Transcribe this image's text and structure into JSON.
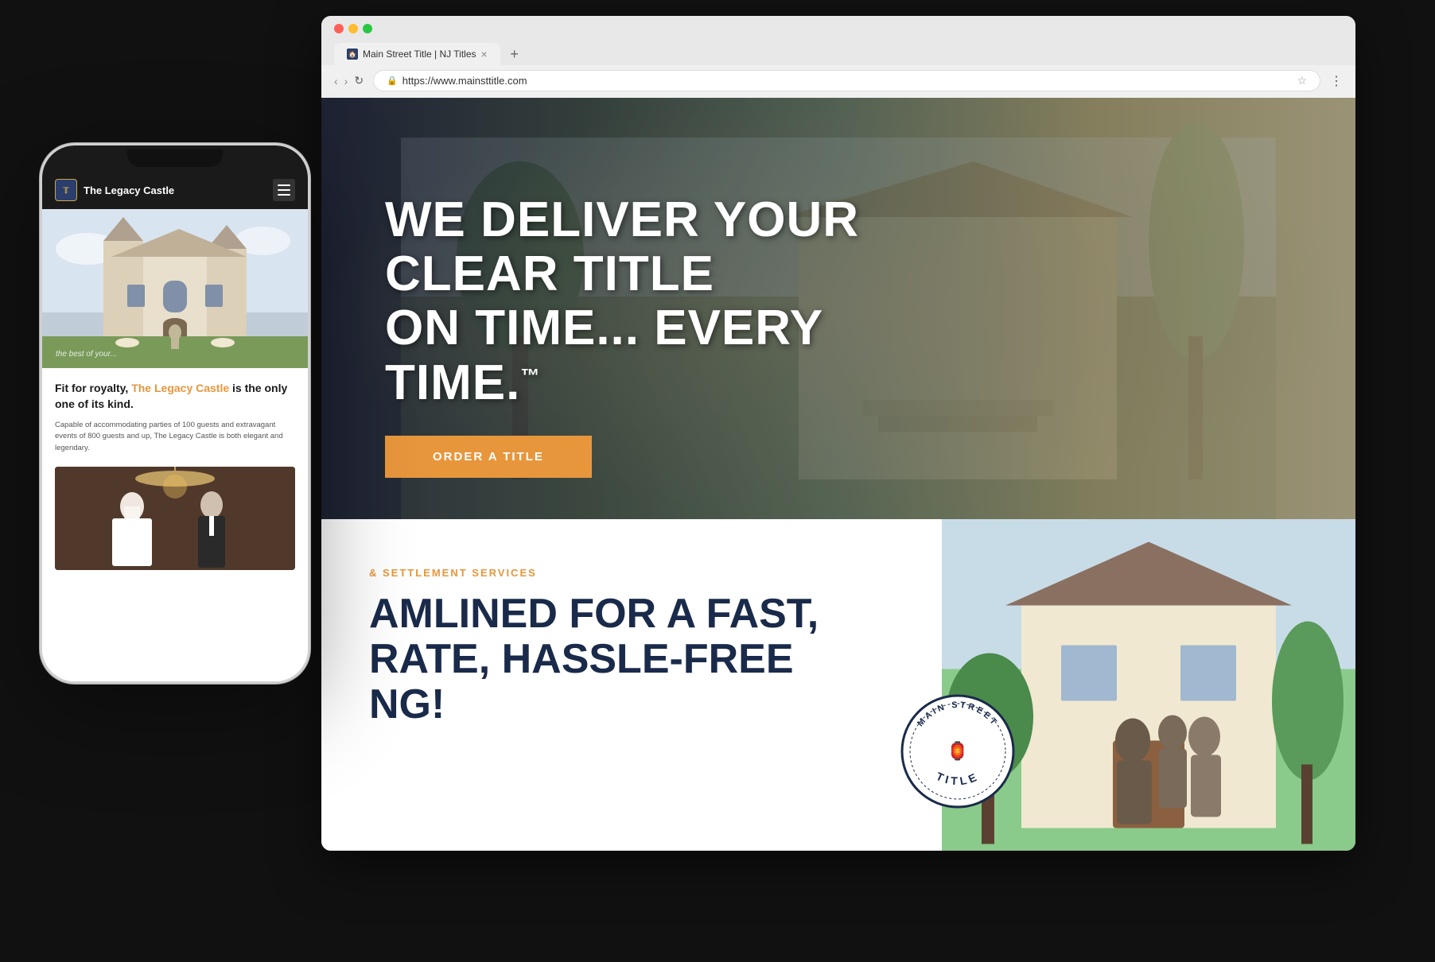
{
  "scene": {
    "bg_color": "#111111"
  },
  "browser": {
    "dots": [
      "#ff5f57",
      "#febc2e",
      "#28c840"
    ],
    "tab": {
      "label": "Main Street Title | NJ Titles",
      "favicon_text": "🏠"
    },
    "tab_new": "+",
    "nav": {
      "back": "‹",
      "forward": "›",
      "refresh": "↻",
      "url": "https://www.mainsttitle.com",
      "bookmark": "☆",
      "more": "⋮"
    }
  },
  "hero": {
    "headline_line1": "WE DELIVER YOUR CLEAR TITLE",
    "headline_line2": "ON TIME... EVERY TIME.",
    "trademark": "™",
    "cta_label": "ORDER A TITLE"
  },
  "services": {
    "label": "& SETTLEMENT SERVICES",
    "headline_line1": "AMLINED FOR A FAST,",
    "headline_line2": "RATE, HASSLE-FREE",
    "headline_line3": "NG!"
  },
  "badge": {
    "top_text": "MAIN STREET",
    "bottom_text": "TITLE",
    "icon": "🏮"
  },
  "phone": {
    "logo_text": "The Legacy Castle",
    "tagline_prefix": "Fit for royalty, ",
    "tagline_highlight": "The Legacy Castle",
    "tagline_suffix": " is the only one of its kind.",
    "body_text": "Capable of accommodating parties of 100 guests and extravagant events of 800 guests and up, The Legacy Castle is both elegant and legendary.",
    "hero_overlay_text": "the best of your..."
  }
}
